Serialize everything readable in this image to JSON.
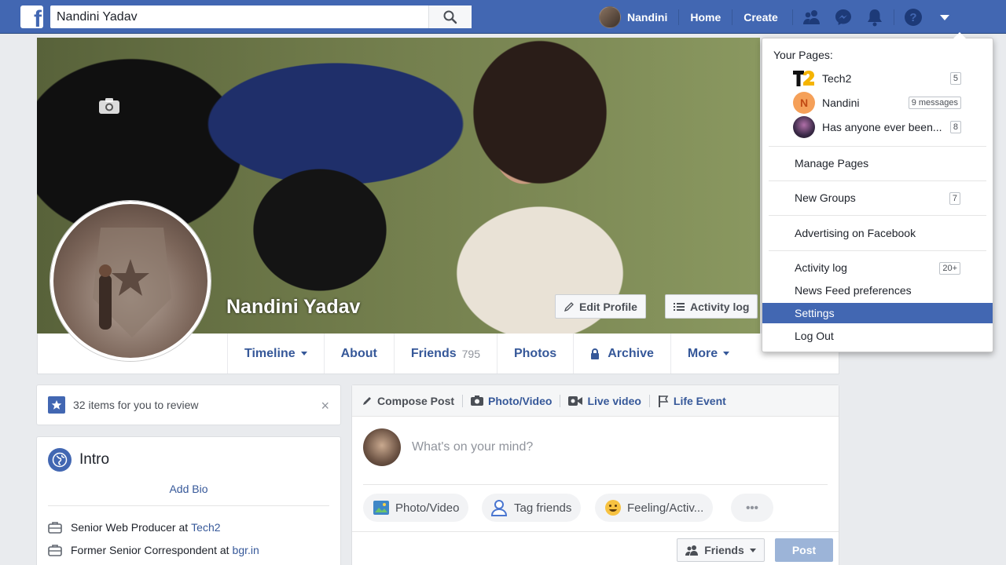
{
  "topbar": {
    "logo": "f",
    "search_value": "Nandini Yadav",
    "profile_name": "Nandini",
    "home": "Home",
    "create": "Create"
  },
  "profile": {
    "name": "Nandini Yadav",
    "edit_profile": "Edit Profile",
    "activity_log": "Activity log"
  },
  "timeline_nav": {
    "timeline": "Timeline",
    "about": "About",
    "friends": "Friends",
    "friends_count": "795",
    "photos": "Photos",
    "archive": "Archive",
    "more": "More"
  },
  "review": {
    "text": "32 items for you to review",
    "close": "×"
  },
  "intro": {
    "title": "Intro",
    "add_bio": "Add Bio",
    "job1_prefix": "Senior Web Producer at",
    "job1_link": "Tech2",
    "job2_prefix": "Former Senior Correspondent at",
    "job2_link": "bgr.in"
  },
  "composer": {
    "tab_compose": "Compose Post",
    "tab_photo": "Photo/Video",
    "tab_live": "Live video",
    "tab_life": "Life Event",
    "placeholder": "What's on your mind?",
    "pill_photo": "Photo/Video",
    "pill_tag": "Tag friends",
    "pill_feeling": "Feeling/Activ...",
    "pill_more": "•••",
    "audience": "Friends",
    "post": "Post"
  },
  "dropdown": {
    "heading": "Your Pages:",
    "pages": [
      {
        "name": "Tech2",
        "badge": "5",
        "initial": "T2"
      },
      {
        "name": "Nandini",
        "badge": "9 messages",
        "initial": "N"
      },
      {
        "name": "Has anyone ever been...",
        "badge": "8",
        "initial": ""
      }
    ],
    "manage_pages": "Manage Pages",
    "new_groups": "New Groups",
    "new_groups_badge": "7",
    "advertising": "Advertising on Facebook",
    "activity_log": "Activity log",
    "activity_badge": "20+",
    "news_feed": "News Feed preferences",
    "settings": "Settings",
    "logout": "Log Out"
  },
  "colors": {
    "brand": "#4267b2",
    "link": "#365899",
    "highlight": "#4267b2"
  }
}
